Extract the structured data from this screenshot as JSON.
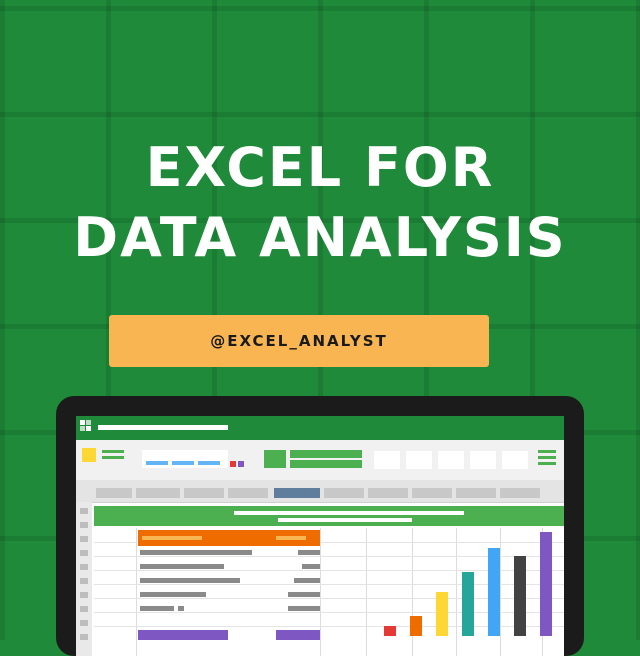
{
  "headline": {
    "line1": "EXCEL FOR",
    "line2": "DATA ANALYSIS"
  },
  "handle": "@EXCEL_ANALYST",
  "colors": {
    "background": "#1e8a3a",
    "handle_bg": "#f8b552",
    "laptop_frame": "#1b1b1b"
  },
  "illustration": {
    "screen": "spreadsheet-app",
    "chart_bar_colors": [
      "#e53935",
      "#ef6c00",
      "#fdd835",
      "#26a69a",
      "#42a5f5",
      "#424242",
      "#7e57c2"
    ]
  }
}
